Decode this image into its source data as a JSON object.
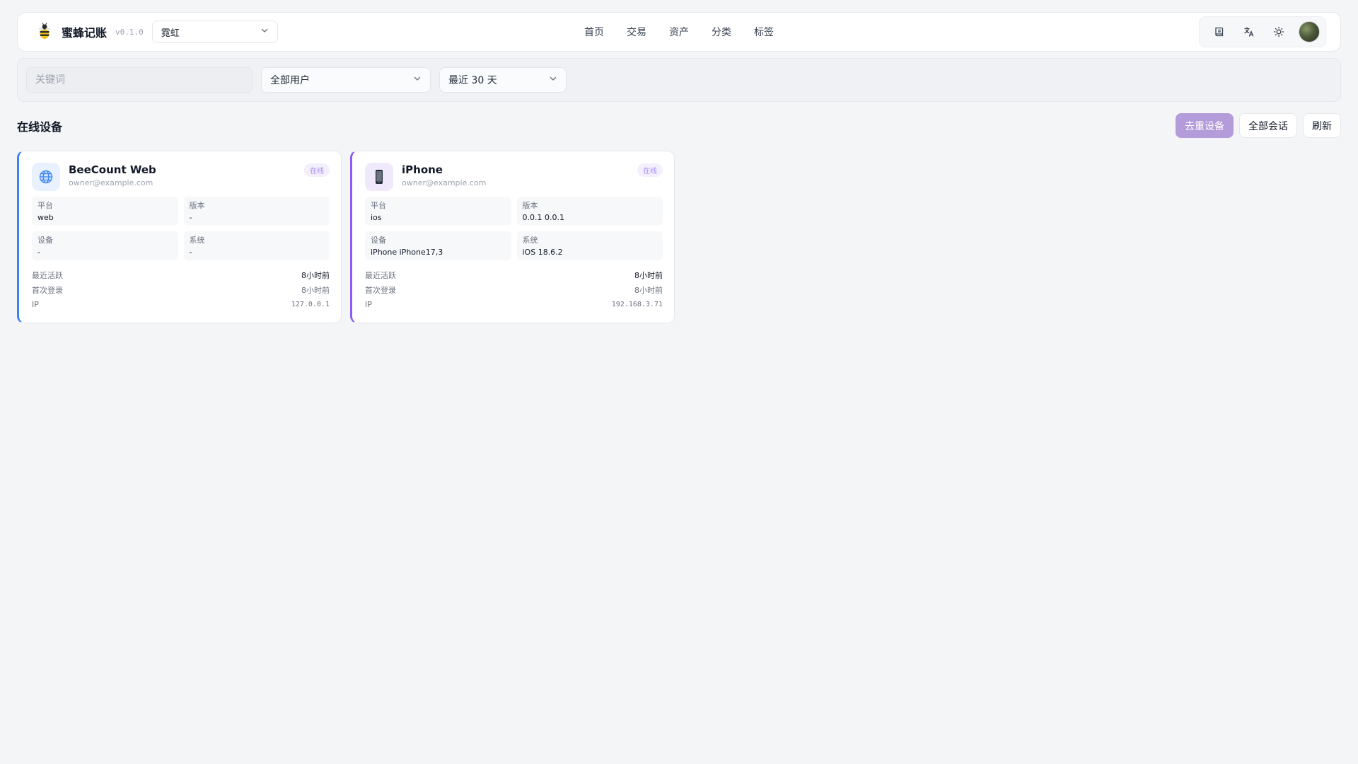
{
  "header": {
    "brand_name": "蜜蜂记账",
    "version": "v0.1.0",
    "ledger_selected": "霓虹",
    "nav": [
      "首页",
      "交易",
      "资产",
      "分类",
      "标签"
    ],
    "icons": [
      "book-icon",
      "translate-icon",
      "sun-icon",
      "avatar"
    ]
  },
  "filters": {
    "keyword_placeholder": "关键词",
    "user_selected": "全部用户",
    "range_selected": "最近 30 天"
  },
  "section": {
    "title": "在线设备",
    "dedupe_label": "去重设备",
    "all_sessions_label": "全部会话",
    "refresh_label": "刷新"
  },
  "devices": [
    {
      "name": "BeeCount Web",
      "user": "owner@example.com",
      "status": "在线",
      "icon": "globe-icon",
      "accent": "#3b82f6",
      "fields": [
        {
          "label": "平台",
          "value": "web"
        },
        {
          "label": "版本",
          "value": "-"
        },
        {
          "label": "设备",
          "value": "-"
        },
        {
          "label": "系统",
          "value": "-"
        }
      ],
      "meta": [
        {
          "key": "最近活跃",
          "value": "8小时前"
        },
        {
          "key": "首次登录",
          "value": "8小时前"
        },
        {
          "key": "IP",
          "value": "127.0.0.1"
        }
      ]
    },
    {
      "name": "iPhone",
      "user": "owner@example.com",
      "status": "在线",
      "icon": "phone-icon",
      "accent": "#8b5cf6",
      "fields": [
        {
          "label": "平台",
          "value": "ios"
        },
        {
          "label": "版本",
          "value": "0.0.1 0.0.1"
        },
        {
          "label": "设备",
          "value": "iPhone iPhone17,3"
        },
        {
          "label": "系统",
          "value": "iOS 18.6.2"
        }
      ],
      "meta": [
        {
          "key": "最近活跃",
          "value": "8小时前"
        },
        {
          "key": "首次登录",
          "value": "8小时前"
        },
        {
          "key": "IP",
          "value": "192.168.3.71"
        }
      ]
    }
  ],
  "colors": {
    "primary": "#b49bd9",
    "web_accent": "#3b82f6",
    "ios_accent": "#8b5cf6",
    "background": "#f4f5f7"
  }
}
